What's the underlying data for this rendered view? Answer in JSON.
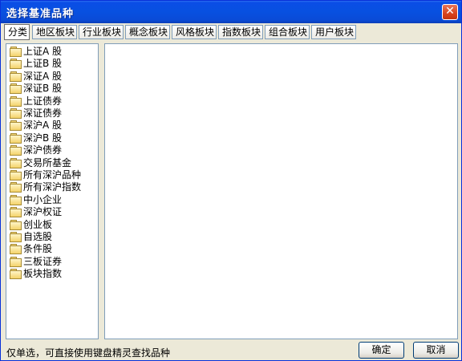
{
  "window": {
    "title": "选择基准品种",
    "close_symbol": "✕"
  },
  "tabs": [
    {
      "label": "分类",
      "active": true
    },
    {
      "label": "地区板块"
    },
    {
      "label": "行业板块"
    },
    {
      "label": "概念板块"
    },
    {
      "label": "风格板块"
    },
    {
      "label": "指数板块"
    },
    {
      "label": "组合板块"
    },
    {
      "label": "用户板块"
    }
  ],
  "tree": {
    "items": [
      "上证A 股",
      "上证B 股",
      "深证A 股",
      "深证B 股",
      "上证债券",
      "深证债券",
      "深沪A 股",
      "深沪B 股",
      "深沪债券",
      "交易所基金",
      "所有深沪品种",
      "所有深沪指数",
      "中小企业",
      "深沪权证",
      "创业板",
      "自选股",
      "条件股",
      "三板证券",
      "板块指数"
    ]
  },
  "footer": {
    "hint": "仅单选，可直接使用键盘精灵查找品种",
    "ok_label": "确定",
    "cancel_label": "取消"
  }
}
